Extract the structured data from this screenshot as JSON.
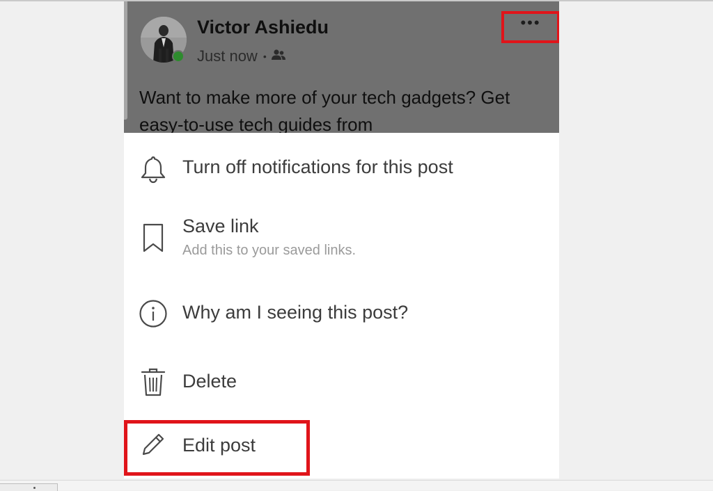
{
  "post": {
    "author": "Victor Ashiedu",
    "timestamp": "Just now",
    "separator": "•",
    "audience_icon": "friends-icon",
    "more_icon": "more-options-icon",
    "more_label": "•••",
    "text": "Want to make more of your tech gadgets? Get easy-to-use tech guides from"
  },
  "menu": {
    "items": [
      {
        "icon": "bell-icon",
        "label": "Turn off notifications for this post"
      },
      {
        "icon": "bookmark-icon",
        "label": "Save link",
        "sublabel": "Add this to your saved links."
      },
      {
        "icon": "info-icon",
        "label": "Why am I seeing this post?"
      },
      {
        "icon": "trash-icon",
        "label": "Delete"
      },
      {
        "icon": "pencil-icon",
        "label": "Edit post"
      }
    ]
  },
  "colors": {
    "highlight": "#e0141a",
    "overlay": "#707070",
    "online": "#2e8b2e",
    "menu_text": "#3c3c3c",
    "menu_subtext": "#9a9a9a"
  }
}
